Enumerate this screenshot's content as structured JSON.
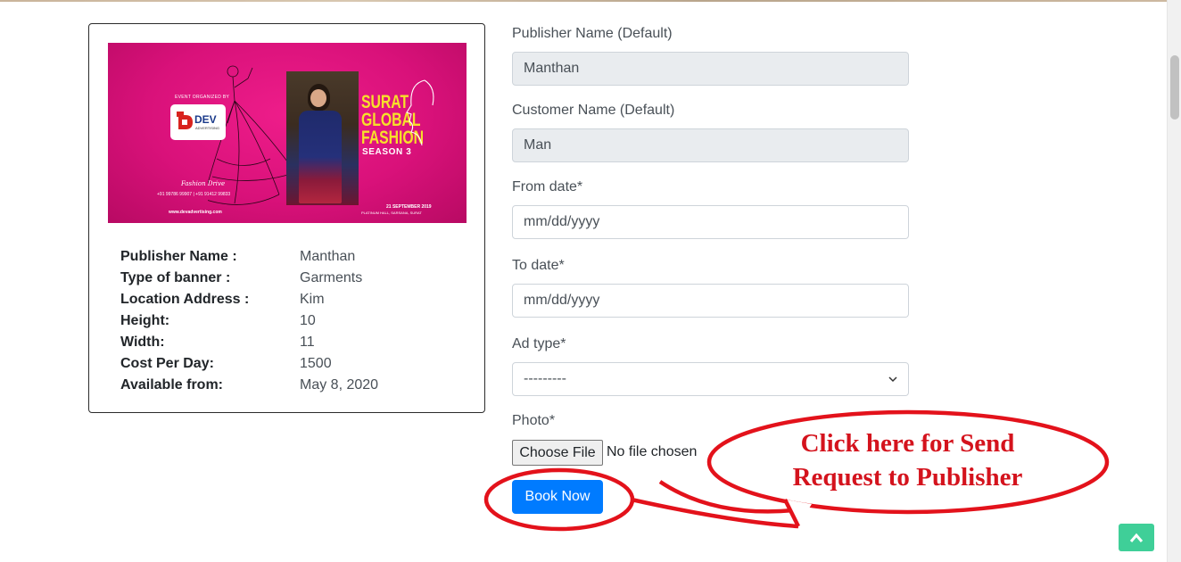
{
  "card": {
    "banner": {
      "organized_by": "EVENT ORGANIZED BY",
      "logo_name": "DEV",
      "logo_sub": "ADVERTISING",
      "title_line1": "SURAT",
      "title_line2": "GLOBAL",
      "title_line3": "FASHION",
      "season": "SEASON 3",
      "date": "21 SEPTEMBER 2019",
      "venue": "PLATINUM HALL, SARSANA, SURAT",
      "phones": "+91 99786 99907 | +91 91412 99833",
      "website": "www.devadvertising.com",
      "signature": "Fashion Drive"
    },
    "details": [
      {
        "label": "Publisher Name :",
        "value": "Manthan"
      },
      {
        "label": "Type of banner :",
        "value": "Garments"
      },
      {
        "label": "Location Address :",
        "value": "Kim"
      },
      {
        "label": "Height:",
        "value": "10"
      },
      {
        "label": "Width:",
        "value": "11"
      },
      {
        "label": "Cost Per Day:",
        "value": "1500"
      },
      {
        "label": "Available from:",
        "value": "May 8, 2020"
      }
    ]
  },
  "form": {
    "publisher_label": "Publisher Name (Default)",
    "publisher_value": "Manthan",
    "customer_label": "Customer Name (Default)",
    "customer_value": "Man",
    "from_label": "From date*",
    "from_placeholder": "mm/dd/yyyy",
    "to_label": "To date*",
    "to_placeholder": "mm/dd/yyyy",
    "adtype_label": "Ad type*",
    "adtype_selected": "---------",
    "photo_label": "Photo*",
    "choose_file": "Choose File",
    "no_file": "No file chosen",
    "book_now": "Book Now"
  },
  "annotation": {
    "line1": "Click here for Send",
    "line2": "Request to Publisher",
    "color": "#d4131d"
  },
  "colors": {
    "primary_button": "#007bff",
    "back_to_top": "#3fcf98",
    "banner_magenta": "#d9117a"
  }
}
